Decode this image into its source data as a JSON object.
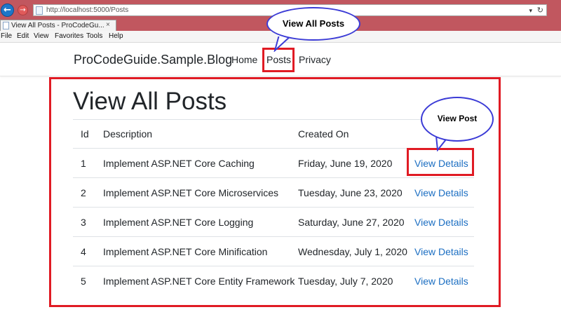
{
  "browser": {
    "url": "http://localhost:5000/Posts",
    "tab_title": "View All Posts - ProCodeGu...",
    "tab_close": "×",
    "menu": [
      "File",
      "Edit",
      "View",
      "Favorites",
      "Tools",
      "Help"
    ]
  },
  "navbar": {
    "brand": "ProCodeGuide.Sample.Blog",
    "links": [
      "Home",
      "Posts",
      "Privacy"
    ]
  },
  "page": {
    "title": "View All Posts",
    "table": {
      "headers": [
        "Id",
        "Description",
        "Created On"
      ],
      "rows": [
        {
          "id": "1",
          "description": "Implement ASP.NET Core Caching",
          "created_on": "Friday, June 19, 2020",
          "action": "View Details"
        },
        {
          "id": "2",
          "description": "Implement ASP.NET Core Microservices",
          "created_on": "Tuesday, June 23, 2020",
          "action": "View Details"
        },
        {
          "id": "3",
          "description": "Implement ASP.NET Core Logging",
          "created_on": "Saturday, June 27, 2020",
          "action": "View Details"
        },
        {
          "id": "4",
          "description": "Implement ASP.NET Core Minification",
          "created_on": "Wednesday, July 1, 2020",
          "action": "View Details"
        },
        {
          "id": "5",
          "description": "Implement ASP.NET Core Entity Framework",
          "created_on": "Tuesday, July 7, 2020",
          "action": "View Details"
        }
      ]
    }
  },
  "annotations": {
    "view_all_posts": "View All Posts",
    "view_post": "View Post"
  },
  "colors": {
    "browser_frame": "#c1575f",
    "link": "#1b6ec2",
    "highlight": "#e01b24",
    "callout_border": "#3b3bd6"
  },
  "icons": {
    "back": "back-arrow-icon",
    "forward": "forward-arrow-icon",
    "page": "page-icon",
    "refresh": "refresh-icon"
  }
}
